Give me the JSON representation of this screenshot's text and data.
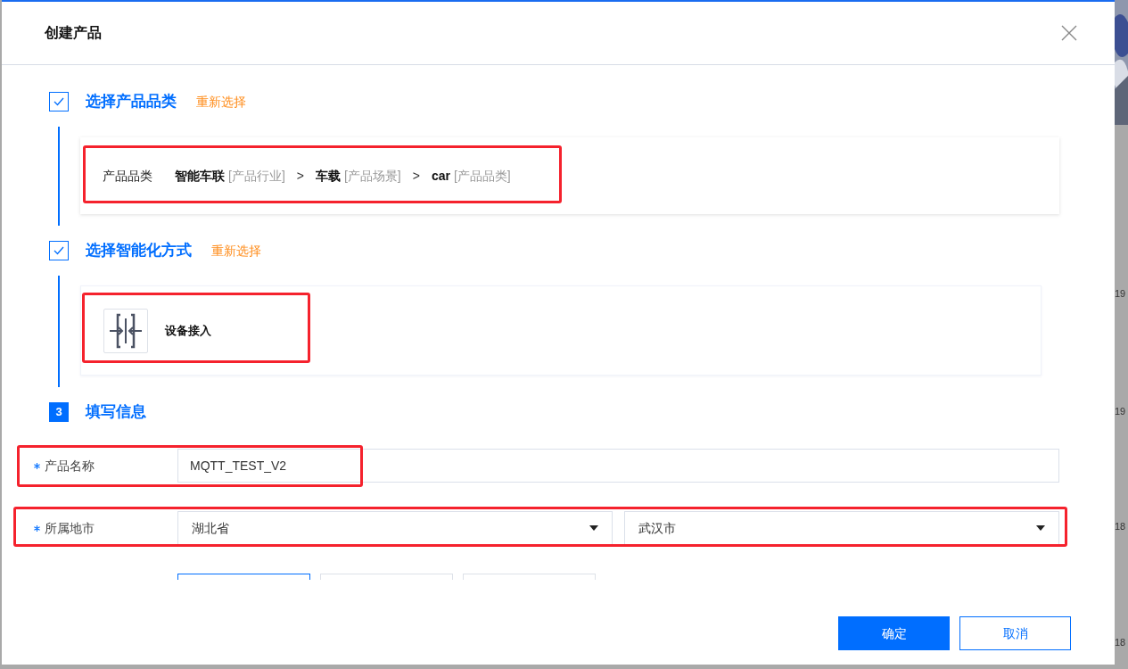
{
  "dialog": {
    "title": "创建产品"
  },
  "steps": [
    {
      "kind": "category",
      "done": true,
      "title": "选择产品品类",
      "action": "重新选择",
      "highlighted": true,
      "label": "产品品类",
      "separator": ">",
      "path": [
        {
          "name": "智能车联",
          "tag": "[产品行业]"
        },
        {
          "name": "车载",
          "tag": "[产品场景]"
        },
        {
          "name": "car",
          "tag": "[产品品类]"
        }
      ]
    },
    {
      "kind": "method",
      "done": true,
      "title": "选择智能化方式",
      "action": "重新选择",
      "highlighted": true,
      "method": "设备接入"
    },
    {
      "kind": "form",
      "done": false,
      "number": "3",
      "title": "填写信息",
      "fields": [
        {
          "kind": "text",
          "label": "产品名称",
          "required": true,
          "highlighted": true,
          "value": "MQTT_TEST_V2"
        },
        {
          "kind": "select-pair",
          "label": "所属地市",
          "required": true,
          "highlighted": true,
          "values": [
            "湖北省",
            "武汉市"
          ]
        },
        {
          "kind": "option-cards",
          "options": [
            {
              "selected": true
            },
            {
              "selected": false
            },
            {
              "selected": false
            }
          ]
        }
      ]
    }
  ],
  "buttons": [
    {
      "label": "确定",
      "primary": true
    },
    {
      "label": "取消",
      "primary": false
    }
  ],
  "background_numbers": [
    "19",
    "19",
    "18",
    "18"
  ]
}
